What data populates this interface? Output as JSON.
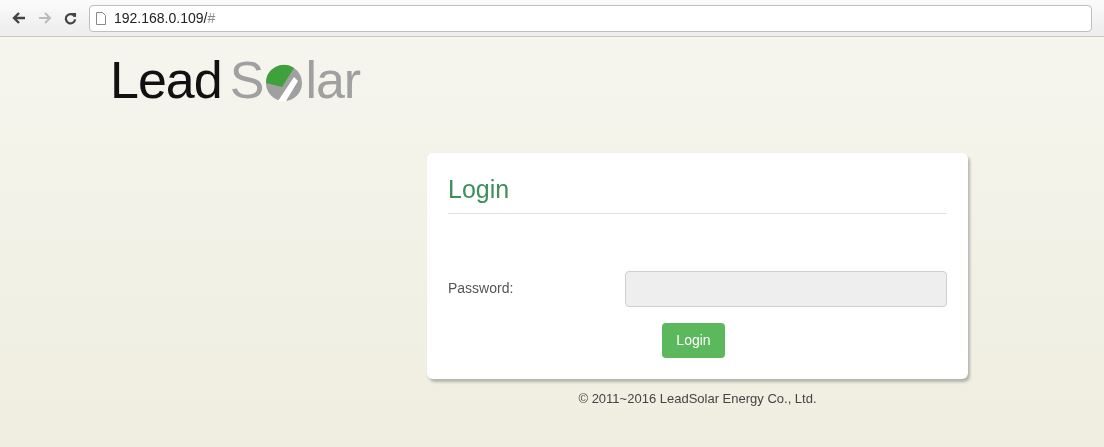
{
  "browser": {
    "address": "192.168.0.109/",
    "address_suffix": "#"
  },
  "logo": {
    "dark": "Lead",
    "light_start": "S",
    "light_end": "lar"
  },
  "login": {
    "title": "Login",
    "password_label": "Password:",
    "button": "Login"
  },
  "footer": "© 2011~2016 LeadSolar Energy Co., Ltd."
}
